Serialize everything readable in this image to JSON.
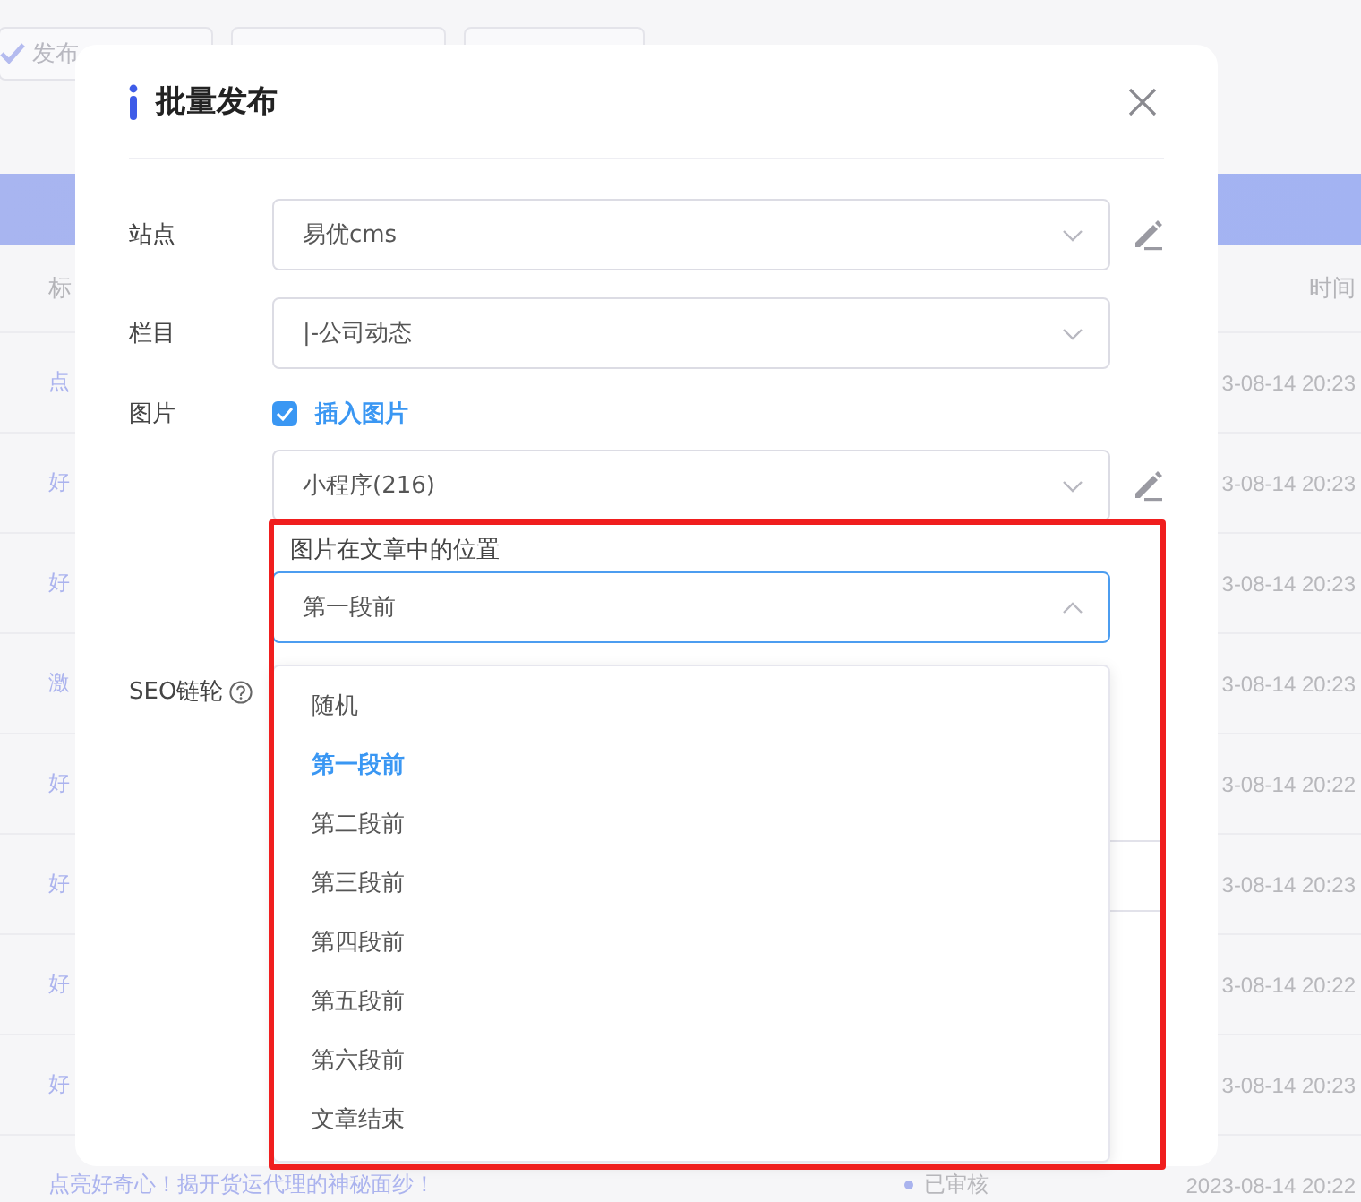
{
  "toolbar": {
    "publish_button": {
      "label": "发布"
    }
  },
  "table": {
    "columns": [
      "标",
      "时间"
    ],
    "rows": [
      {
        "title": "点",
        "time": "3-08-14 20:23"
      },
      {
        "title": "好",
        "time": "3-08-14 20:23"
      },
      {
        "title": "好",
        "time": "3-08-14 20:23"
      },
      {
        "title": "激",
        "time": "3-08-14 20:23"
      },
      {
        "title": "好",
        "time": "3-08-14 20:22"
      },
      {
        "title": "好",
        "time": "3-08-14 20:23"
      },
      {
        "title": "好",
        "time": "3-08-14 20:22"
      },
      {
        "title": "好",
        "time": "3-08-14 20:23"
      },
      {
        "title": "点亮好奇心！揭开货运代理的神秘面纱！",
        "status": "已审核",
        "time": "2023-08-14 20:22"
      }
    ]
  },
  "dialog": {
    "title": "批量发布",
    "fields": [
      {
        "kind": "select",
        "label": "站点",
        "value": "易优cms",
        "editable": true,
        "expanded": false
      },
      {
        "kind": "select",
        "label": "栏目",
        "value": "|-公司动态",
        "editable": false,
        "expanded": false
      },
      {
        "kind": "checkbox",
        "label": "图片",
        "text": "插入图片",
        "checked": true
      },
      {
        "kind": "select",
        "value": "小程序(216)",
        "editable": true,
        "expanded": false
      },
      {
        "kind": "select",
        "caption": "图片在文章中的位置",
        "value": "第一段前",
        "editable": false,
        "expanded": true
      },
      {
        "kind": "input",
        "label": "SEO链轮",
        "help": true
      }
    ],
    "dropdown": {
      "options": [
        {
          "label": "随机",
          "selected": false
        },
        {
          "label": "第一段前",
          "selected": true
        },
        {
          "label": "第二段前",
          "selected": false
        },
        {
          "label": "第三段前",
          "selected": false
        },
        {
          "label": "第四段前",
          "selected": false
        },
        {
          "label": "第五段前",
          "selected": false
        },
        {
          "label": "第六段前",
          "selected": false
        },
        {
          "label": "文章结束",
          "selected": false
        }
      ]
    }
  }
}
